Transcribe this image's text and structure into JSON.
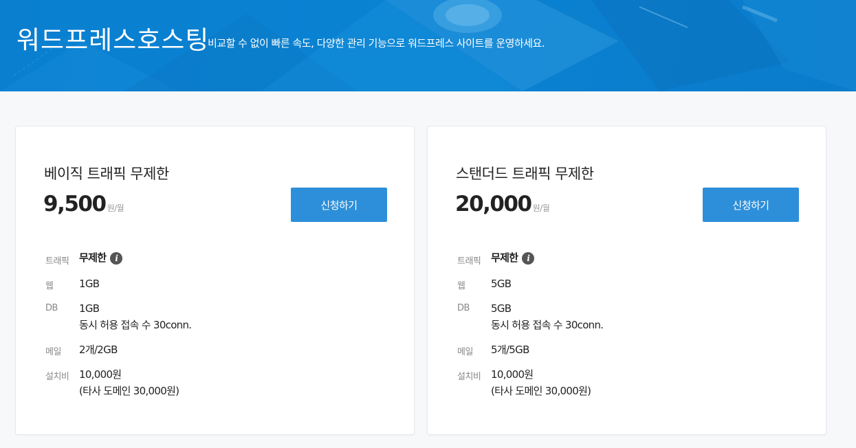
{
  "hero": {
    "title": "워드프레스호스팅",
    "subtitle": "비교할 수 없이 빠른 속도, 다양한 관리 기능으로 워드프레스 사이트를 운영하세요."
  },
  "plans": [
    {
      "name": "베이직 트래픽 무제한",
      "price": "9,500",
      "price_unit": "원/월",
      "button_label": "신청하기",
      "specs": {
        "traffic_label": "트래픽",
        "traffic_value": "무제한",
        "web_label": "웹",
        "web_value": "1GB",
        "db_label": "DB",
        "db_value": "1GB",
        "db_conn": "동시 허용 접속 수 30conn.",
        "mail_label": "메일",
        "mail_value": "2개/2GB",
        "setup_label": "설치비",
        "setup_value": "10,000원",
        "setup_note": "(타사 도메인 30,000원)"
      }
    },
    {
      "name": "스탠더드 트래픽 무제한",
      "price": "20,000",
      "price_unit": "원/월",
      "button_label": "신청하기",
      "specs": {
        "traffic_label": "트래픽",
        "traffic_value": "무제한",
        "web_label": "웹",
        "web_value": "5GB",
        "db_label": "DB",
        "db_value": "5GB",
        "db_conn": "동시 허용 접속 수 30conn.",
        "mail_label": "메일",
        "mail_value": "5개/5GB",
        "setup_label": "설치비",
        "setup_value": "10,000원",
        "setup_note": "(타사 도메인 30,000원)"
      }
    }
  ],
  "icons": {
    "info": "info-icon"
  },
  "colors": {
    "hero_bg": "#0a7fd0",
    "button_bg": "#2d8fd9",
    "page_bg": "#f7f8fa"
  }
}
